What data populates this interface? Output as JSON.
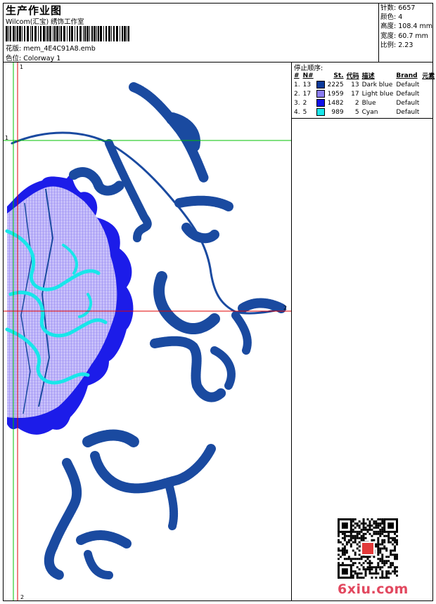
{
  "header": {
    "title": "生产作业图",
    "company": "Wilcom(汇宝) 绣饰工作室",
    "design_label": "花版:",
    "design_name": "mem_4E4C91A8.emb",
    "colorway_label": "色位:",
    "colorway_name": "Colorway 1"
  },
  "stats": [
    {
      "label": "针数:",
      "value": "6657"
    },
    {
      "label": "颜色:",
      "value": "4"
    },
    {
      "label": "高度:",
      "value": "108.4 mm"
    },
    {
      "label": "宽度:",
      "value": "60.7 mm"
    },
    {
      "label": "比例:",
      "value": "2.23"
    }
  ],
  "stop_sequence": {
    "title": "停止顺序:",
    "columns": [
      "#",
      "N#",
      "St.",
      "代码",
      "描述",
      "Brand",
      "元素"
    ],
    "rows": [
      {
        "idx": "1.",
        "n": "13",
        "color": "#0b3a9a",
        "st": "2225",
        "code": "13",
        "desc": "Dark blue",
        "brand": "Default"
      },
      {
        "idx": "2.",
        "n": "17",
        "color": "#8a7cf0",
        "st": "1959",
        "code": "17",
        "desc": "Light blue",
        "brand": "Default"
      },
      {
        "idx": "3.",
        "n": "2",
        "color": "#1010e8",
        "st": "1482",
        "code": "2",
        "desc": "Blue",
        "brand": "Default"
      },
      {
        "idx": "4.",
        "n": "5",
        "color": "#18e6ea",
        "st": "989",
        "code": "5",
        "desc": "Cyan",
        "brand": "Default"
      }
    ]
  },
  "guides": {
    "v1": "1",
    "h1": "1",
    "h2": "2",
    "v2": "2"
  },
  "watermark": "6xiu.com",
  "colors": {
    "dark_blue": "#1a4aa0",
    "light_blue": "#8a7cf0",
    "blue": "#1010e8",
    "cyan": "#18e6ea",
    "guide_green": "#00c000",
    "guide_red": "#e00000"
  }
}
